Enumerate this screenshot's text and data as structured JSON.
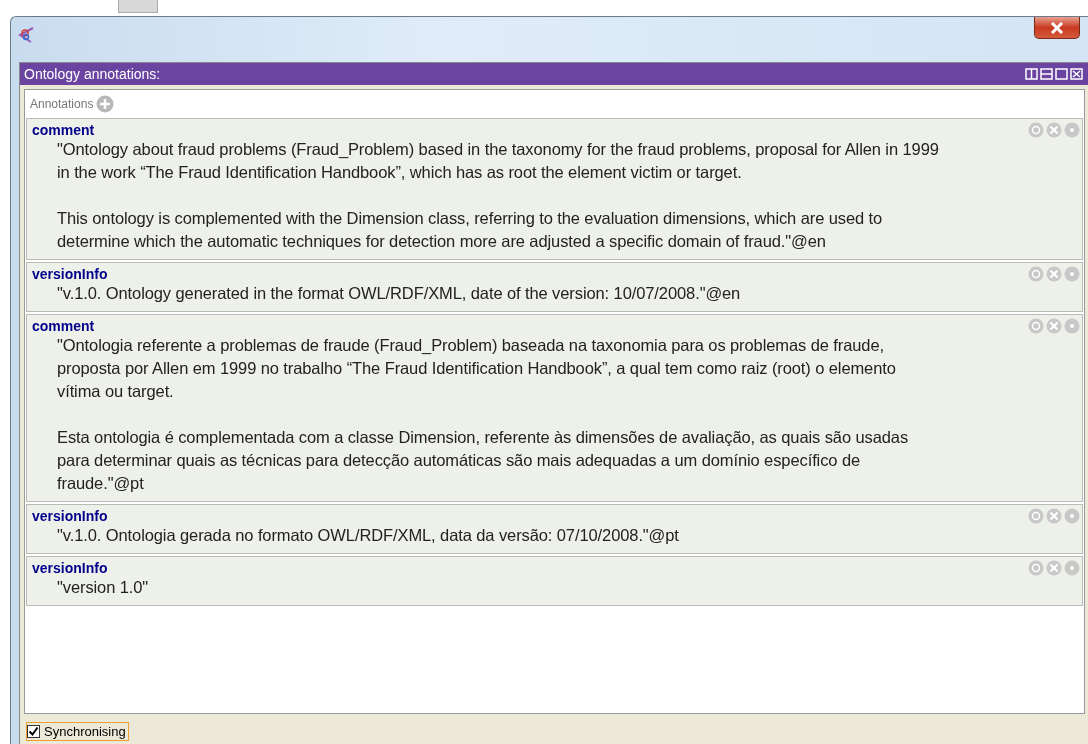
{
  "panel": {
    "title": "Ontology annotations:"
  },
  "annotations_header": {
    "label": "Annotations"
  },
  "annotations": [
    {
      "property": "comment",
      "paragraphs": [
        [
          "\"Ontology about fraud problems (Fraud_Problem) based in the taxonomy for the fraud problems, proposal for Allen in 1999",
          "in the work “The Fraud Identification Handbook”, which has as root the element victim or target."
        ],
        [
          "This ontology is complemented with the Dimension class, referring to the evaluation dimensions, which are used to",
          "determine which the automatic techniques for detection more are adjusted a specific domain of fraud.\"@en"
        ]
      ]
    },
    {
      "property": "versionInfo",
      "paragraphs": [
        [
          "\"v.1.0. Ontology generated in the format OWL/RDF/XML, date of the version: 10/07/2008.\"@en"
        ]
      ]
    },
    {
      "property": "comment",
      "paragraphs": [
        [
          "\"Ontologia referente a problemas de fraude (Fraud_Problem) baseada na  taxonomia para os problemas de fraude,",
          "proposta por Allen em 1999 no trabalho “The Fraud Identification Handbook”, a qual tem como  raiz (root) o elemento",
          "vítima ou target."
        ],
        [
          "Esta ontologia é complementada com a classe Dimension, referente às dimensões de avaliação, as quais são usadas",
          "para determinar quais as técnicas para detecção automáticas são mais adequadas a um domínio específico de",
          "fraude.\"@pt"
        ]
      ]
    },
    {
      "property": "versionInfo",
      "paragraphs": [
        [
          "\"v.1.0. Ontologia gerada no formato OWL/RDF/XML, data da versão: 07/10/2008.\"@pt"
        ]
      ]
    },
    {
      "property": "versionInfo",
      "paragraphs": [
        [
          "\"version 1.0\""
        ]
      ]
    }
  ],
  "footer": {
    "label": "Synchronising",
    "checked": true
  }
}
